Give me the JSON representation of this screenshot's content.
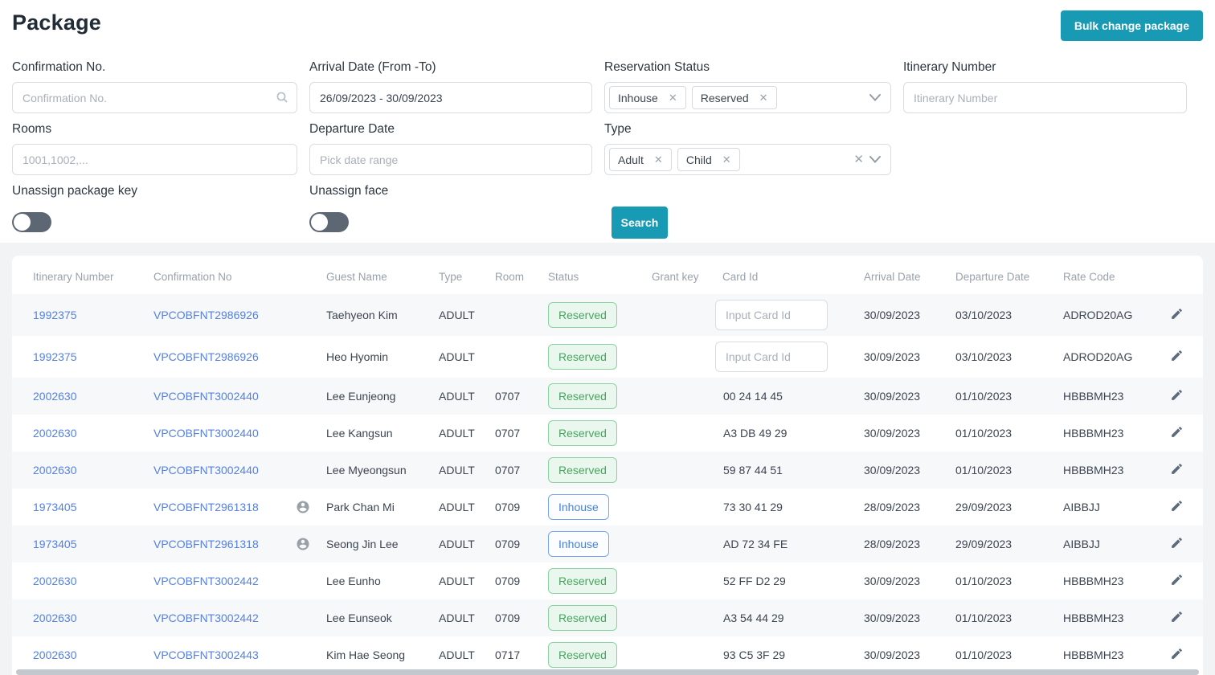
{
  "page": {
    "title": "Package"
  },
  "header": {
    "bulk_button": "Bulk change package"
  },
  "filters": {
    "confirmation": {
      "label": "Confirmation No.",
      "placeholder": "Confirmation No."
    },
    "arrival": {
      "label": "Arrival Date (From -To)",
      "value": "26/09/2023 - 30/09/2023"
    },
    "reservation_status": {
      "label": "Reservation Status",
      "tags": [
        "Inhouse",
        "Reserved"
      ]
    },
    "itinerary": {
      "label": "Itinerary Number",
      "placeholder": "Itinerary Number"
    },
    "rooms": {
      "label": "Rooms",
      "placeholder": "1001,1002,..."
    },
    "departure": {
      "label": "Departure Date",
      "placeholder": "Pick date range"
    },
    "type": {
      "label": "Type",
      "tags": [
        "Adult",
        "Child"
      ]
    },
    "unassign_package_key": {
      "label": "Unassign package key",
      "state": "off"
    },
    "unassign_face": {
      "label": "Unassign face",
      "state": "off"
    },
    "search_button": "Search"
  },
  "table": {
    "headers": [
      "Itinerary Number",
      "Confirmation No",
      "Guest Name",
      "Type",
      "Room",
      "Status",
      "Grant key",
      "Card Id",
      "Arrival Date",
      "Departure Date",
      "Rate Code"
    ],
    "card_input_placeholder": "Input Card Id",
    "rows": [
      {
        "itinerary": "1992375",
        "confirmation": "VPCOBFNT2986926",
        "face": false,
        "guest": "Taehyeon Kim",
        "type": "ADULT",
        "room": "",
        "status": "Reserved",
        "grant_key": "",
        "card_id": "",
        "card_input": true,
        "arrival": "30/09/2023",
        "departure": "03/10/2023",
        "rate": "ADROD20AG"
      },
      {
        "itinerary": "1992375",
        "confirmation": "VPCOBFNT2986926",
        "face": false,
        "guest": "Heo Hyomin",
        "type": "ADULT",
        "room": "",
        "status": "Reserved",
        "grant_key": "",
        "card_id": "",
        "card_input": true,
        "arrival": "30/09/2023",
        "departure": "03/10/2023",
        "rate": "ADROD20AG"
      },
      {
        "itinerary": "2002630",
        "confirmation": "VPCOBFNT3002440",
        "face": false,
        "guest": "Lee Eunjeong",
        "type": "ADULT",
        "room": "0707",
        "status": "Reserved",
        "grant_key": "",
        "card_id": "00 24 14 45",
        "card_input": false,
        "arrival": "30/09/2023",
        "departure": "01/10/2023",
        "rate": "HBBBMH23"
      },
      {
        "itinerary": "2002630",
        "confirmation": "VPCOBFNT3002440",
        "face": false,
        "guest": "Lee Kangsun",
        "type": "ADULT",
        "room": "0707",
        "status": "Reserved",
        "grant_key": "",
        "card_id": "A3 DB 49 29",
        "card_input": false,
        "arrival": "30/09/2023",
        "departure": "01/10/2023",
        "rate": "HBBBMH23"
      },
      {
        "itinerary": "2002630",
        "confirmation": "VPCOBFNT3002440",
        "face": false,
        "guest": "Lee Myeongsun",
        "type": "ADULT",
        "room": "0707",
        "status": "Reserved",
        "grant_key": "",
        "card_id": "59 87 44 51",
        "card_input": false,
        "arrival": "30/09/2023",
        "departure": "01/10/2023",
        "rate": "HBBBMH23"
      },
      {
        "itinerary": "1973405",
        "confirmation": "VPCOBFNT2961318",
        "face": true,
        "guest": "Park Chan Mi",
        "type": "ADULT",
        "room": "0709",
        "status": "Inhouse",
        "grant_key": "",
        "card_id": "73 30 41 29",
        "card_input": false,
        "arrival": "28/09/2023",
        "departure": "29/09/2023",
        "rate": "AIBBJJ"
      },
      {
        "itinerary": "1973405",
        "confirmation": "VPCOBFNT2961318",
        "face": true,
        "guest": "Seong Jin Lee",
        "type": "ADULT",
        "room": "0709",
        "status": "Inhouse",
        "grant_key": "",
        "card_id": "AD 72 34 FE",
        "card_input": false,
        "arrival": "28/09/2023",
        "departure": "29/09/2023",
        "rate": "AIBBJJ"
      },
      {
        "itinerary": "2002630",
        "confirmation": "VPCOBFNT3002442",
        "face": false,
        "guest": "Lee Eunho",
        "type": "ADULT",
        "room": "0709",
        "status": "Reserved",
        "grant_key": "",
        "card_id": "52 FF D2 29",
        "card_input": false,
        "arrival": "30/09/2023",
        "departure": "01/10/2023",
        "rate": "HBBBMH23"
      },
      {
        "itinerary": "2002630",
        "confirmation": "VPCOBFNT3002442",
        "face": false,
        "guest": "Lee Eunseok",
        "type": "ADULT",
        "room": "0709",
        "status": "Reserved",
        "grant_key": "",
        "card_id": "A3 54 44 29",
        "card_input": false,
        "arrival": "30/09/2023",
        "departure": "01/10/2023",
        "rate": "HBBBMH23"
      },
      {
        "itinerary": "2002630",
        "confirmation": "VPCOBFNT3002443",
        "face": false,
        "guest": "Kim Hae Seong",
        "type": "ADULT",
        "room": "0717",
        "status": "Reserved",
        "grant_key": "",
        "card_id": "93 C5 3F 29",
        "card_input": false,
        "arrival": "30/09/2023",
        "departure": "01/10/2023",
        "rate": "HBBBMH23"
      }
    ]
  },
  "colors": {
    "accent_teal": "#1899b4",
    "link_blue": "#5480e4",
    "badge_reserved_text": "#49a45f",
    "badge_reserved_bg": "#e9f7ee",
    "badge_reserved_border": "#8ad3a0",
    "badge_inhouse_text": "#4a7fd8",
    "badge_inhouse_border": "#78a5ea",
    "toggle_off_track": "#5d6773",
    "page_bg": "#f2f3f5",
    "row_alt_bg": "#f7f8fa",
    "header_text": "#99a1ab"
  }
}
